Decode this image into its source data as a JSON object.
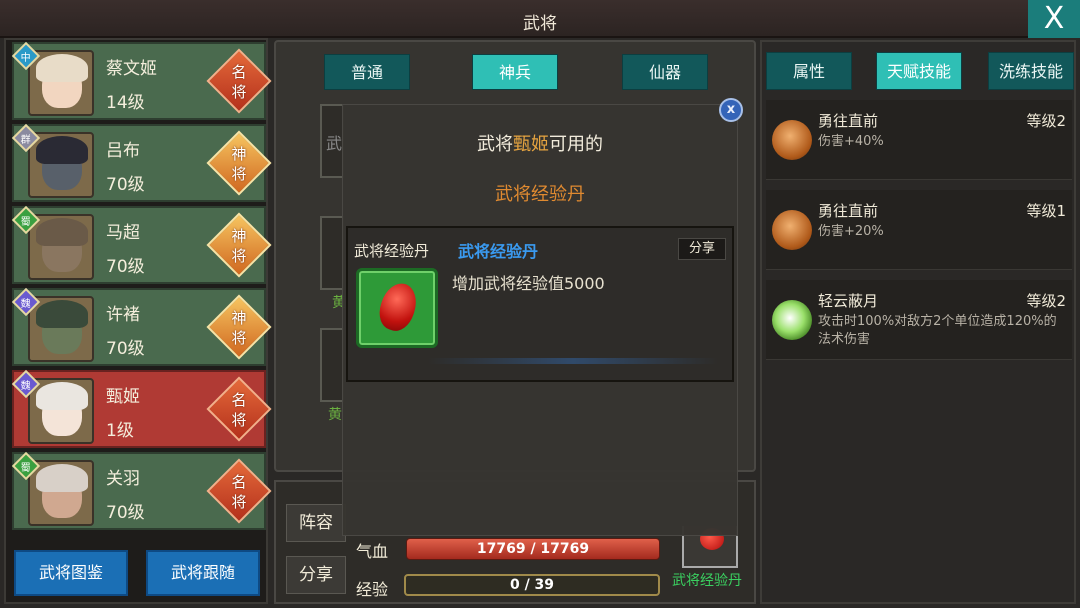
{
  "header": {
    "title": "武将",
    "close_label": "X"
  },
  "roster": {
    "heroes": [
      {
        "name": "蔡文姬",
        "level": "14级",
        "faction": "中",
        "faction_color": "#2a9ac8",
        "rank": [
          "名",
          "将"
        ],
        "rank_style": "red",
        "selected": false,
        "hair": "#e8dcc8",
        "face": "#f2d6c0"
      },
      {
        "name": "吕布",
        "level": "70级",
        "faction": "群",
        "faction_color": "#8a8aa0",
        "rank": [
          "神",
          "将"
        ],
        "rank_style": "gold",
        "selected": false,
        "hair": "#2a2a34",
        "face": "#58606a"
      },
      {
        "name": "马超",
        "level": "70级",
        "faction": "蜀",
        "faction_color": "#3aa040",
        "rank": [
          "神",
          "将"
        ],
        "rank_style": "gold",
        "selected": false,
        "hair": "#6a5a48",
        "face": "#8a7660"
      },
      {
        "name": "许褚",
        "level": "70级",
        "faction": "魏",
        "faction_color": "#6a5ad0",
        "rank": [
          "神",
          "将"
        ],
        "rank_style": "gold",
        "selected": false,
        "hair": "#3a4a3a",
        "face": "#6a7a5a"
      },
      {
        "name": "甄姬",
        "level": "1级",
        "faction": "魏",
        "faction_color": "#6a5ad0",
        "rank": [
          "名",
          "将"
        ],
        "rank_style": "red",
        "selected": true,
        "hair": "#eae6e0",
        "face": "#f4e4d8"
      },
      {
        "name": "关羽",
        "level": "70级",
        "faction": "蜀",
        "faction_color": "#3aa040",
        "rank": [
          "名",
          "将"
        ],
        "rank_style": "red",
        "selected": false,
        "hair": "#d8d0c8",
        "face": "#d0a890"
      }
    ],
    "buttons": {
      "encyclopedia": "武将图鉴",
      "follow": "武将跟随"
    }
  },
  "middle": {
    "tabs": [
      {
        "label": "普通",
        "active": false
      },
      {
        "label": "神兵",
        "active": true
      },
      {
        "label": "仙器",
        "active": false
      }
    ],
    "bg_labels": {
      "lineup_glyph": "武",
      "slot_a": "黄",
      "slot_b": "黄"
    }
  },
  "bottom": {
    "lineup_button": "阵容",
    "share_button": "分享",
    "hp_label": "气血",
    "hp_value": "17769 / 17769",
    "hp_fraction": 1.0,
    "xp_label": "经验",
    "xp_value": "0 / 39",
    "xp_fraction": 0.0,
    "item_name": "武将经验丹"
  },
  "right": {
    "tabs": [
      {
        "label": "属性",
        "active": false
      },
      {
        "label": "天赋技能",
        "active": true
      },
      {
        "label": "洗练技能",
        "active": false
      }
    ],
    "skills": [
      {
        "name": "勇往直前",
        "level": "等级2",
        "desc": "伤害+40%",
        "icon": "fist-icon"
      },
      {
        "name": "勇往直前",
        "level": "等级1",
        "desc": "伤害+20%",
        "icon": "fist-icon"
      },
      {
        "name": "轻云蔽月",
        "level": "等级2",
        "desc": "攻击时100%对敌方2个单位造成120%的法术伤害",
        "icon": "cloud-moon-icon"
      }
    ]
  },
  "modal": {
    "line1_prefix": "武将",
    "line1_hero": "甄姬",
    "line1_suffix": "可用的",
    "line2": "武将经验丹",
    "item": {
      "label": "武将经验丹",
      "name": "武将经验丹",
      "share": "分享",
      "description": "增加武将经验值5000"
    },
    "close_label": "x"
  },
  "colors": {
    "tab_active": "#2fbfb5",
    "tab_inactive": "#12585a",
    "selected_card": "#b03a34",
    "card": "#4a6a4e",
    "highlight_orange": "#e6a440",
    "item_blue": "#3a9af0",
    "item_green": "#3ad060"
  }
}
